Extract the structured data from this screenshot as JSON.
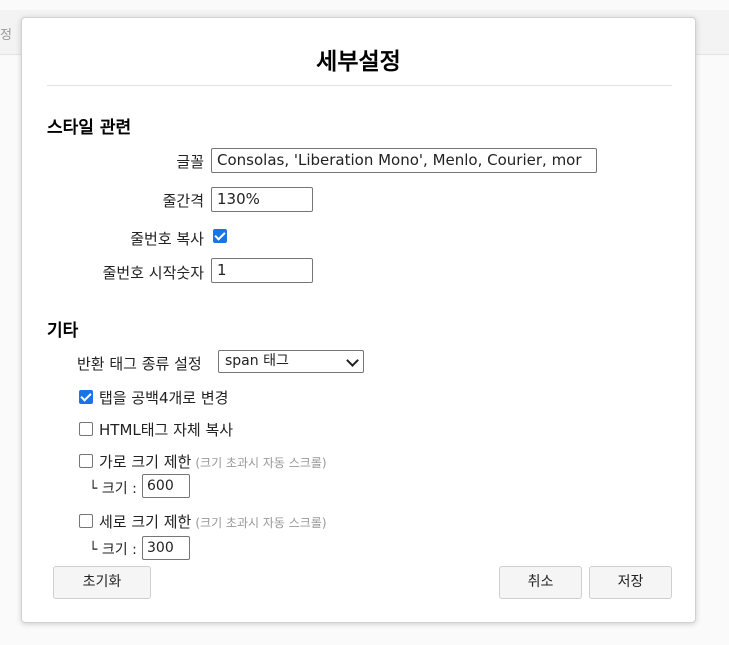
{
  "background": {
    "partial_text": "정"
  },
  "dialog": {
    "title": "세부설정",
    "style_section": {
      "title": "스타일 관련",
      "font_label": "글꼴",
      "font_value": "Consolas, 'Liberation Mono', Menlo, Courier, mor",
      "line_height_label": "줄간격",
      "line_height_value": "130%",
      "copy_line_numbers_label": "줄번호 복사",
      "copy_line_numbers_checked": true,
      "line_start_label": "줄번호 시작숫자",
      "line_start_value": "1"
    },
    "etc_section": {
      "title": "기타",
      "return_tag_label": "반환 태그 종류 설정",
      "return_tag_selected": "span 태그",
      "tab_to_spaces_label": "탭을 공백4개로 변경",
      "tab_to_spaces_checked": true,
      "copy_html_tag_label": "HTML태그 자체 복사",
      "copy_html_tag_checked": false,
      "width_limit_label": "가로 크기 제한",
      "width_limit_hint": "(크기 초과시 자동 스크롤)",
      "width_limit_checked": false,
      "width_size_label": "└ 크기 :",
      "width_size_value": "600",
      "height_limit_label": "세로 크기 제한",
      "height_limit_hint": "(크기 초과시 자동 스크롤)",
      "height_limit_checked": false,
      "height_size_label": "└ 크기 :",
      "height_size_value": "300"
    },
    "buttons": {
      "reset": "초기화",
      "cancel": "취소",
      "save": "저장"
    }
  },
  "colors": {
    "checkbox_checked": "#1a73e8",
    "hint_text": "#999999"
  }
}
